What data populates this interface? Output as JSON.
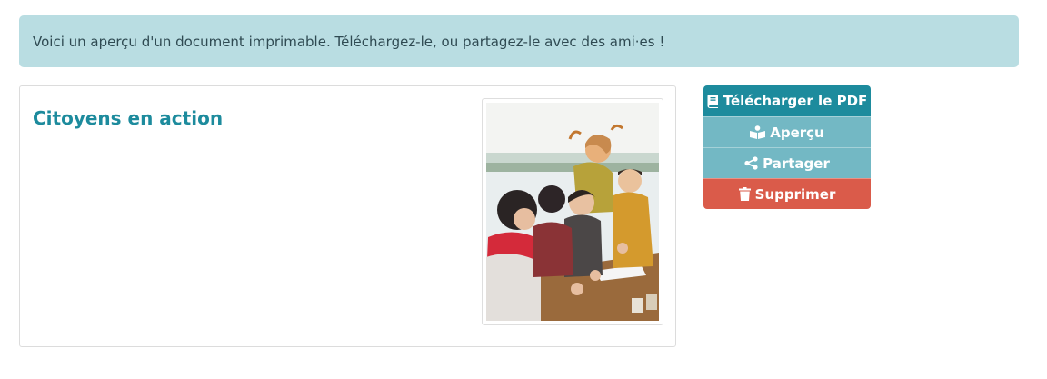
{
  "alert": {
    "message": "Voici un aperçu d'un document imprimable. Téléchargez-le, ou partagez-le avec des ami·es !"
  },
  "document": {
    "title": "Citoyens en action"
  },
  "actions": {
    "download": {
      "label": "Télécharger le PDF",
      "icon": "book-icon"
    },
    "preview": {
      "label": "Aperçu",
      "icon": "reader-icon"
    },
    "share": {
      "label": "Partager",
      "icon": "share-icon"
    },
    "delete": {
      "label": "Supprimer",
      "icon": "trash-icon"
    }
  },
  "colors": {
    "alert_bg": "#b9dde2",
    "title": "#1d8b9d",
    "primary": "#1d8b9d",
    "secondary": "#73b8c4",
    "danger": "#da5b4a"
  }
}
